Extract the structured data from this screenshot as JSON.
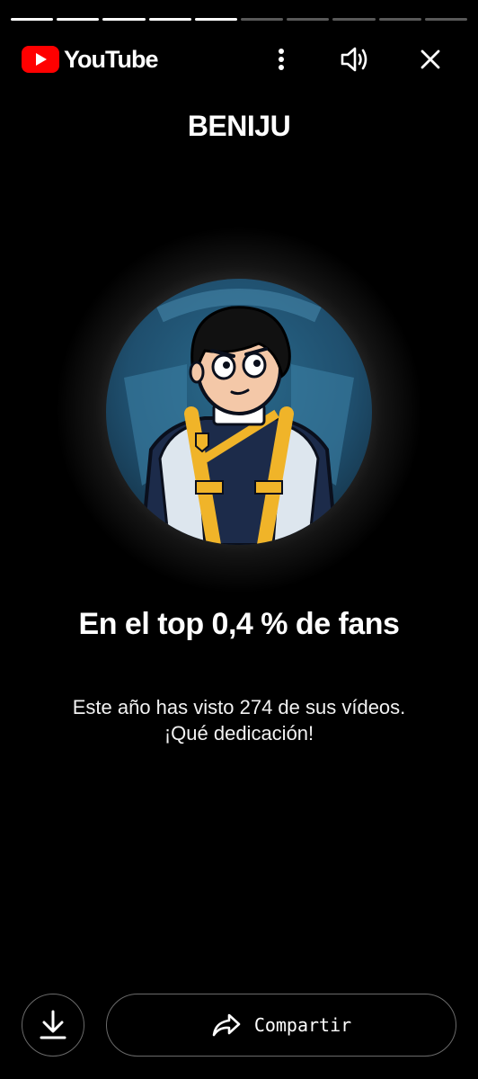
{
  "story_progress": {
    "total_segments": 10,
    "completed_segments": 5
  },
  "header": {
    "logo_text": "YouTube",
    "brand_color": "#FF0000",
    "more_icon": "more-vertical-icon",
    "sound_icon": "volume-icon",
    "close_icon": "close-icon"
  },
  "card": {
    "channel_name": "BENIJU",
    "headline": "En el top 0,4 % de fans",
    "line1": "Este año has visto 274 de sus vídeos.",
    "line2": "¡Qué dedicación!"
  },
  "actions": {
    "download_icon": "download-icon",
    "share_icon": "share-arrow-icon",
    "share_label": "Compartir"
  }
}
